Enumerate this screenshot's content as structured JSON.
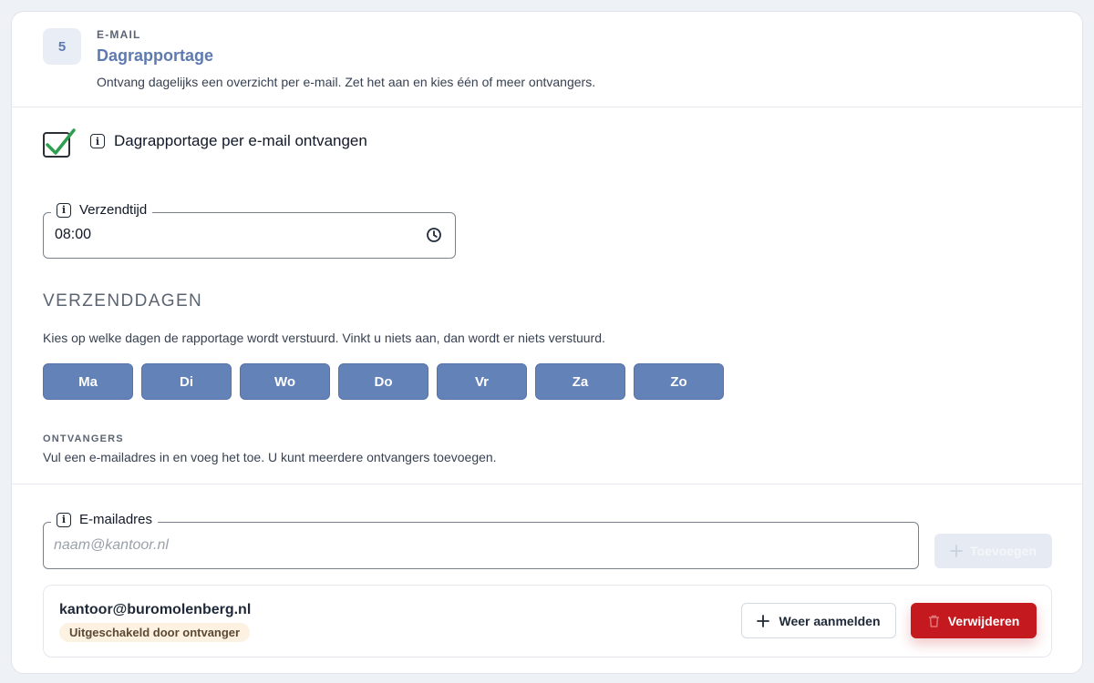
{
  "step": {
    "number": "5",
    "eyebrow": "E-MAIL",
    "title": "Dagrapportage",
    "description": "Ontvang dagelijks een overzicht per e-mail. Zet het aan en kies één of meer ontvangers."
  },
  "enable": {
    "label": "Dagrapportage per e-mail ontvangen",
    "checked": true
  },
  "send_time": {
    "label": "Verzendtijd",
    "value": "08:00"
  },
  "days": {
    "heading": "VERZENDDAGEN",
    "hint": "Kies op welke dagen de rapportage wordt verstuurd. Vinkt u niets aan, dan wordt er niets verstuurd.",
    "items": [
      "Ma",
      "Di",
      "Wo",
      "Do",
      "Vr",
      "Za",
      "Zo"
    ]
  },
  "recipients": {
    "eyebrow": "ONTVANGERS",
    "hint": "Vul een e-mailadres in en voeg het toe. U kunt meerdere ontvangers toevoegen.",
    "email_label": "E-mailadres",
    "email_placeholder": "naam@kantoor.nl",
    "add_label": "Toevoegen",
    "list": [
      {
        "email": "kantoor@buromolenberg.nl",
        "status": "Uitgeschakeld door ontvanger",
        "resubscribe_label": "Weer aanmelden",
        "delete_label": "Verwijderen"
      }
    ]
  },
  "colors": {
    "accent": "#6382b8",
    "check": "#2e9e4f",
    "danger": "#c41a1f",
    "badge_bg": "#fdf1e2"
  },
  "icons": [
    "info-icon",
    "clock-icon",
    "plus-icon",
    "trash-icon",
    "checkmark-icon"
  ]
}
